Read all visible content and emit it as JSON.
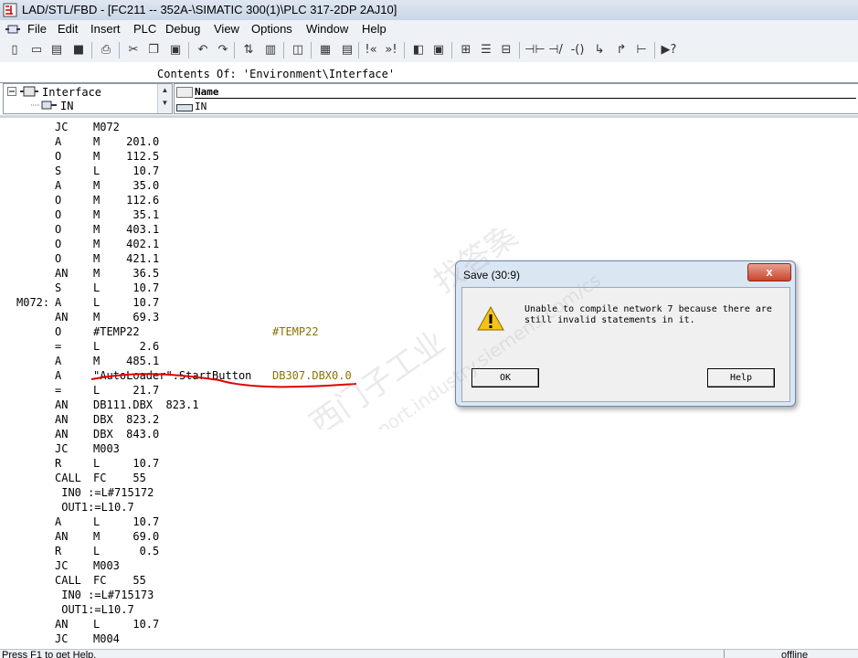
{
  "window": {
    "title": "LAD/STL/FBD  - [FC211 -- 352A-\\SIMATIC 300(1)\\PLC 317-2DP 2AJ10]"
  },
  "menu": [
    "File",
    "Edit",
    "Insert",
    "PLC",
    "Debug",
    "View",
    "Options",
    "Window",
    "Help"
  ],
  "toolbar_icons": [
    "new-icon",
    "open-icon",
    "folder-icon",
    "save-icon",
    "print-icon",
    "cut-icon",
    "copy-icon",
    "paste-icon",
    "undo-icon",
    "redo-icon",
    "load-icon",
    "diagnose-icon",
    "block-icon",
    "overview-icon",
    "rung-start-icon",
    "rung-end-icon",
    "panel-icon",
    "view-icon",
    "program-icon",
    "table-icon",
    "contact-icon",
    "nc-contact-icon",
    "coil-icon",
    "branch-open-icon",
    "branch-close-icon",
    "connector-icon",
    "help-icon"
  ],
  "interface": {
    "contents_of": "Contents Of: 'Environment\\Interface'",
    "tree_root": "Interface",
    "tree_child": "IN",
    "column_header": "Name",
    "column_value": "IN"
  },
  "code_lines": [
    {
      "label": "",
      "op": "JC",
      "addr": "M072",
      "comment": ""
    },
    {
      "label": "",
      "op": "A",
      "addr": "M    201.0",
      "comment": ""
    },
    {
      "label": "",
      "op": "O",
      "addr": "M    112.5",
      "comment": ""
    },
    {
      "label": "",
      "op": "S",
      "addr": "L     10.7",
      "comment": ""
    },
    {
      "label": "",
      "op": "A",
      "addr": "M     35.0",
      "comment": ""
    },
    {
      "label": "",
      "op": "O",
      "addr": "M    112.6",
      "comment": ""
    },
    {
      "label": "",
      "op": "O",
      "addr": "M     35.1",
      "comment": ""
    },
    {
      "label": "",
      "op": "O",
      "addr": "M    403.1",
      "comment": ""
    },
    {
      "label": "",
      "op": "O",
      "addr": "M    402.1",
      "comment": ""
    },
    {
      "label": "",
      "op": "O",
      "addr": "M    421.1",
      "comment": ""
    },
    {
      "label": "",
      "op": "AN",
      "addr": "M     36.5",
      "comment": ""
    },
    {
      "label": "",
      "op": "S",
      "addr": "L     10.7",
      "comment": ""
    },
    {
      "label": "M072:",
      "op": "A",
      "addr": "L     10.7",
      "comment": ""
    },
    {
      "label": "",
      "op": "AN",
      "addr": "M     69.3",
      "comment": ""
    },
    {
      "label": "",
      "op": "O",
      "addr": "#TEMP22",
      "comment": "#TEMP22"
    },
    {
      "label": "",
      "op": "=",
      "addr": "L      2.6",
      "comment": ""
    },
    {
      "label": "",
      "op": "A",
      "addr": "M    485.1",
      "comment": ""
    },
    {
      "label": "",
      "op": "A",
      "addr": "\"AutoLoader\".StartButton",
      "comment": "DB307.DBX0.0"
    },
    {
      "label": "",
      "op": "=",
      "addr": "L     21.7",
      "comment": ""
    },
    {
      "label": "",
      "op": "AN",
      "addr": "DB111.DBX  823.1",
      "comment": ""
    },
    {
      "label": "",
      "op": "AN",
      "addr": "DBX  823.2",
      "comment": ""
    },
    {
      "label": "",
      "op": "AN",
      "addr": "DBX  843.0",
      "comment": ""
    },
    {
      "label": "",
      "op": "JC",
      "addr": "M003",
      "comment": ""
    },
    {
      "label": "",
      "op": "R",
      "addr": "L     10.7",
      "comment": ""
    },
    {
      "label": "",
      "op": "CALL",
      "addr": "FC    55",
      "comment": ""
    },
    {
      "label": "",
      "op": " IN0 :=L#715172",
      "addr": "",
      "comment": ""
    },
    {
      "label": "",
      "op": " OUT1:=L10.7",
      "addr": "",
      "comment": ""
    },
    {
      "label": "",
      "op": "A",
      "addr": "L     10.7",
      "comment": ""
    },
    {
      "label": "",
      "op": "AN",
      "addr": "M     69.0",
      "comment": ""
    },
    {
      "label": "",
      "op": "R",
      "addr": "L      0.5",
      "comment": ""
    },
    {
      "label": "",
      "op": "JC",
      "addr": "M003",
      "comment": ""
    },
    {
      "label": "",
      "op": "CALL",
      "addr": "FC    55",
      "comment": ""
    },
    {
      "label": "",
      "op": " IN0 :=L#715173",
      "addr": "",
      "comment": ""
    },
    {
      "label": "",
      "op": " OUT1:=L10.7",
      "addr": "",
      "comment": ""
    },
    {
      "label": "",
      "op": "AN",
      "addr": "L     10.7",
      "comment": ""
    },
    {
      "label": "",
      "op": "JC",
      "addr": "M004",
      "comment": ""
    }
  ],
  "dialog": {
    "title": "Save (30:9)",
    "message": "Unable to compile network 7 because there are\nstill invalid statements in it.",
    "ok_label": "OK",
    "help_label": "Help",
    "close_label": "x"
  },
  "status": {
    "text": "Press F1 to get Help.",
    "mode": "offline"
  },
  "watermark": {
    "line1": "西门子工业",
    "line2": "support.industry.siemens.com/cs",
    "line3": "找答案"
  },
  "colors": {
    "comment": "#8a7400",
    "annotation": "#e00000",
    "titlebar": "#c9d6e6"
  }
}
